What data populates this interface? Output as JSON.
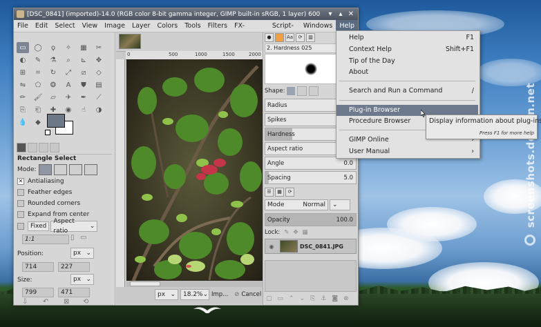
{
  "window": {
    "title": "[DSC_0841] (imported)-14.0 (RGB color 8-bit gamma integer, GIMP built-in sRGB, 1 layer) 600",
    "minimize": "▾",
    "maximize": "▴",
    "close": "✕"
  },
  "menubar": [
    "File",
    "Edit",
    "Select",
    "View",
    "Image",
    "Layer",
    "Colors",
    "Tools",
    "Filters",
    "FX-Foundry",
    "Script-Fu",
    "Windows",
    "Help"
  ],
  "toolbox": {
    "tool_options_title": "Rectangle Select",
    "mode_label": "Mode:",
    "antialiasing": "Antialiasing",
    "feather_edges": "Feather edges",
    "rounded_corners": "Rounded corners",
    "expand_from_center": "Expand from center",
    "fixed_label": "Fixed",
    "fixed_option": "Aspect ratio",
    "ratio_value": "1:1",
    "position_label": "Position:",
    "position_unit": "px",
    "position_x": "714",
    "position_y": "227",
    "size_label": "Size:",
    "size_unit": "px",
    "size_w": "799",
    "size_h": "471"
  },
  "canvas": {
    "ruler_ticks": [
      "0",
      "500",
      "1000",
      "1500",
      "2000"
    ],
    "unit": "px",
    "zoom": "18.2%",
    "status": "Imp...",
    "cancel": "Cancel"
  },
  "dock": {
    "brush_name": "2. Hardness 025",
    "shape_label": "Shape:",
    "params": [
      {
        "label": "Radius",
        "value": "",
        "fill": 0
      },
      {
        "label": "Spikes",
        "value": "",
        "fill": 0
      },
      {
        "label": "Hardness",
        "value": "",
        "fill": 0.3
      },
      {
        "label": "Aspect ratio",
        "value": "",
        "fill": 0
      },
      {
        "label": "Angle",
        "value": "0.0",
        "fill": 0
      },
      {
        "label": "Spacing",
        "value": "5.0",
        "fill": 0.04
      }
    ],
    "mode_label": "Mode",
    "mode_value": "Normal",
    "opacity_label": "Opacity",
    "opacity_value": "100.0",
    "lock_label": "Lock:",
    "layer_name": "DSC_0841.JPG"
  },
  "help_menu": {
    "items": [
      {
        "label": "Help",
        "shortcut": "F1"
      },
      {
        "label": "Context Help",
        "shortcut": "Shift+F1"
      },
      {
        "label": "Tip of the Day",
        "shortcut": ""
      },
      {
        "label": "About",
        "shortcut": ""
      },
      {
        "label": "Search and Run a Command",
        "shortcut": "/"
      },
      {
        "label": "Plug-in Browser",
        "shortcut": ""
      },
      {
        "label": "Procedure Browser",
        "shortcut": ""
      },
      {
        "label": "GIMP Online",
        "shortcut": "›"
      },
      {
        "label": "User Manual",
        "shortcut": "›"
      }
    ]
  },
  "tooltip": {
    "text": "Display information about plug-ins",
    "hint": "Press F1 for more help"
  },
  "watermark": "screenshots.debian.net"
}
